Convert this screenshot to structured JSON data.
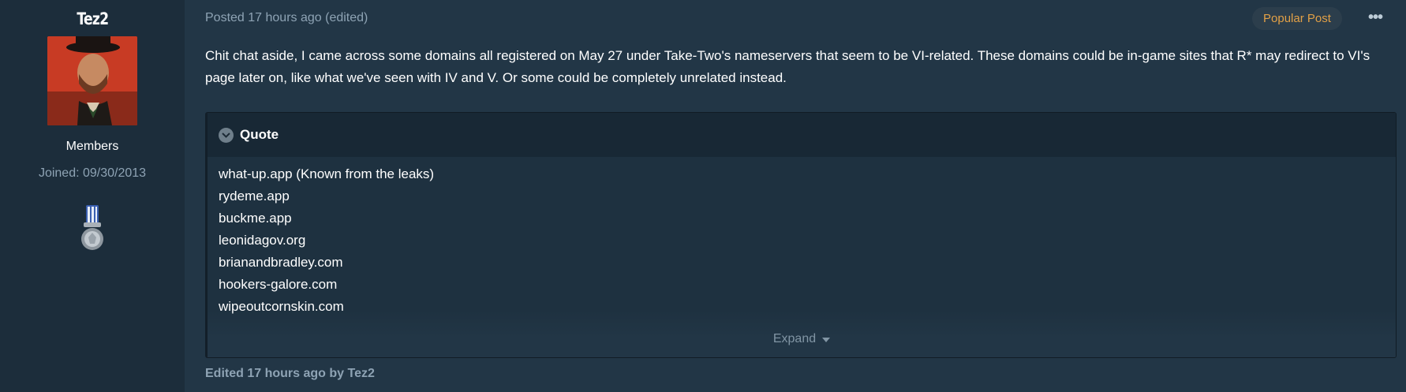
{
  "author": {
    "name": "Tez2",
    "group": "Members",
    "joined": "Joined: 09/30/2013"
  },
  "post": {
    "meta": "Posted 17 hours ago (edited)",
    "popular_badge": "Popular Post",
    "more_icon": "more-horizontal-icon",
    "more_label": "•••",
    "body": "Chit chat aside, I came across some domains all registered on May 27 under Take-Two's nameservers that seem to be VI-related. These domains could be in-game sites that R* may redirect to VI's page later on, like what we've seen with IV and V. Or some could be completely unrelated instead.",
    "quote": {
      "title": "Quote",
      "items": [
        "what-up.app (Known from the leaks)",
        "rydeme.app",
        "buckme.app",
        "leonidagov.org",
        "brianandbradley.com",
        "hookers-galore.com",
        "wipeoutcornskin.com"
      ],
      "expand_label": "Expand"
    },
    "edited": "Edited 17 hours ago by Tez2"
  },
  "colors": {
    "background": "#223646",
    "sidebar": "#1c2d3b",
    "accent_popular": "#e2a046",
    "muted_text": "#8ea3b4"
  }
}
